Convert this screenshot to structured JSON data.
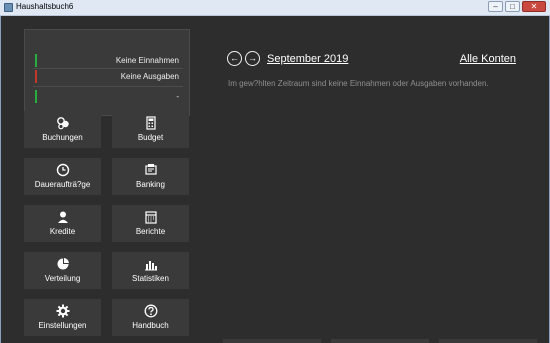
{
  "window": {
    "title": "Haushaltsbuch6"
  },
  "colors": {
    "income": "#27ae3c",
    "expense": "#c0392b",
    "balance": "#27ae3c"
  },
  "summary": {
    "income_label": "Keine Einnahmen",
    "expense_label": "Keine Ausgaben",
    "balance_label": "-"
  },
  "tiles": [
    {
      "label": "Buchungen",
      "icon": "coins-icon"
    },
    {
      "label": "Budget",
      "icon": "calculator-icon"
    },
    {
      "label": "Daueraufträ?ge",
      "icon": "clock-icon"
    },
    {
      "label": "Banking",
      "icon": "bank-icon"
    },
    {
      "label": "Kredite",
      "icon": "user-icon"
    },
    {
      "label": "Berichte",
      "icon": "calendar-icon"
    },
    {
      "label": "Verteilung",
      "icon": "pie-chart-icon"
    },
    {
      "label": "Statistiken",
      "icon": "bar-chart-icon"
    },
    {
      "label": "Einstellungen",
      "icon": "gear-icon"
    },
    {
      "label": "Handbuch",
      "icon": "help-icon"
    }
  ],
  "header": {
    "month": "September 2019",
    "accounts_link": "Alle Konten"
  },
  "content": {
    "empty_message": "Im gew?hlten Zeitraum sind keine Einnahmen oder Ausgaben vorhanden."
  }
}
